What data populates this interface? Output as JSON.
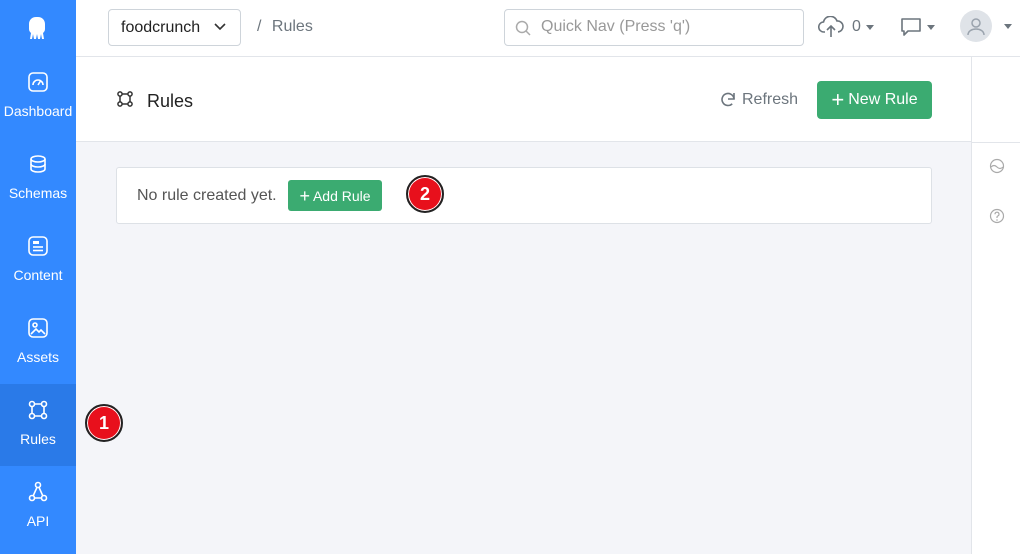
{
  "sidebar": {
    "items": [
      {
        "label": "Dashboard",
        "icon": "dashboard-icon"
      },
      {
        "label": "Schemas",
        "icon": "schemas-icon"
      },
      {
        "label": "Content",
        "icon": "content-icon"
      },
      {
        "label": "Assets",
        "icon": "assets-icon"
      },
      {
        "label": "Rules",
        "icon": "rules-icon",
        "active": true
      },
      {
        "label": "API",
        "icon": "api-icon"
      }
    ]
  },
  "topbar": {
    "app_name": "foodcrunch",
    "breadcrumb_sep": "/",
    "breadcrumb_current": "Rules",
    "search_placeholder": "Quick Nav (Press 'q')",
    "upload_count": "0"
  },
  "header": {
    "title": "Rules",
    "refresh_label": "Refresh",
    "new_rule_label": "New Rule"
  },
  "content": {
    "empty_text": "No rule created yet.",
    "add_rule_label": "Add Rule"
  },
  "markers": [
    "1",
    "2"
  ],
  "colors": {
    "sidebar": "#3389ff",
    "sidebar_active": "#2a7ae8",
    "accent_green": "#3bab71",
    "marker_red": "#e8101c"
  }
}
